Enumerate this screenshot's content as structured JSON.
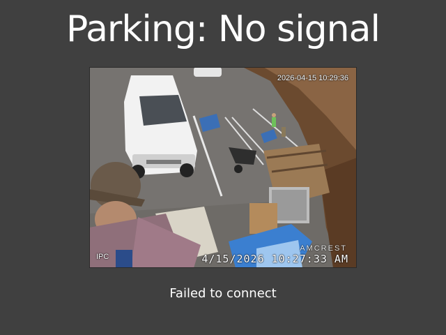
{
  "header": {
    "title": "Parking: No signal"
  },
  "camera": {
    "timestamp_top": "2026-04-15 10:29:36",
    "timestamp_bottom": "4/15/2026 10:27:33 AM",
    "channel_label": "IPC",
    "brand": "AMCREST"
  },
  "status": {
    "message": "Failed to connect"
  },
  "colors": {
    "background": "#404040",
    "text": "#ffffff"
  }
}
